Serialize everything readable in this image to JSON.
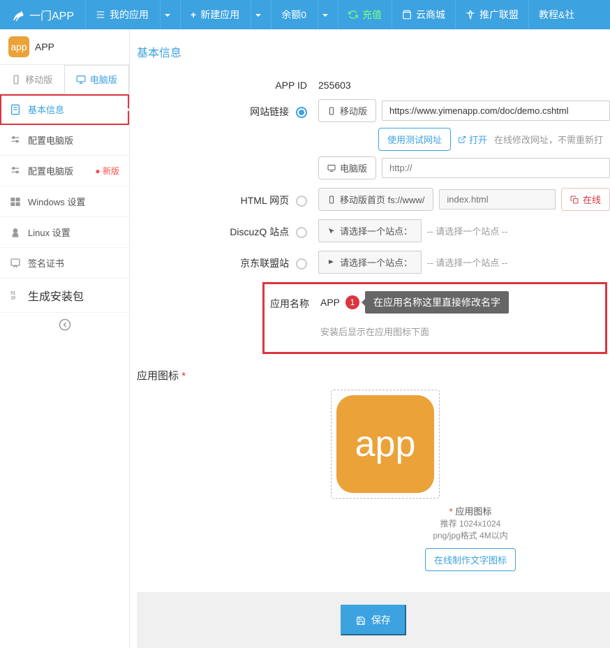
{
  "brand": "一门APP",
  "nav": {
    "my_apps": "我的应用",
    "new_app": "新建应用",
    "balance": "余额0",
    "recharge": "充值",
    "cloud_mall": "云商城",
    "promo": "推广联盟",
    "tutorial": "教程&社"
  },
  "app": {
    "name": "APP",
    "icon_text": "app"
  },
  "platform_tabs": {
    "mobile": "移动版",
    "desktop": "电脑版"
  },
  "menu": {
    "basic": "基本信息",
    "config_desktop": "配置电脑版",
    "config_desktop_new": "配置电脑版",
    "new_badge": "● 新版",
    "windows": "Windows 设置",
    "linux": "Linux 设置",
    "signing": "签名证书",
    "build": "生成安装包"
  },
  "section": {
    "title": "基本信息"
  },
  "fields": {
    "app_id_label": "APP ID",
    "app_id_value": "255603",
    "url_label": "网站链接",
    "mobile_btn": "移动版",
    "mobile_url": "https://www.yimenapp.com/doc/demo.cshtml",
    "test_url_btn": "使用测试网址",
    "open_link": "打开",
    "url_hint": "在线修改网址，不需重新打",
    "desktop_btn": "电脑版",
    "desktop_placeholder": "http://",
    "html_label": "HTML 网页",
    "html_btn": "移动版首页 fs://www/",
    "html_placeholder": "index.html",
    "html_right_btn": "在线",
    "discuz_label": "DiscuzQ 站点",
    "discuz_select": "请选择一个站点：",
    "discuz_placeholder": "-- 请选择一个站点 --",
    "jd_label": "京东联盟站",
    "jd_select": "请选择一个站点：",
    "jd_placeholder": "-- 请选择一个站点 --",
    "app_name_label": "应用名称",
    "app_name_value": "APP",
    "badge_num": "1",
    "tooltip": "在应用名称这里直接修改名字",
    "app_name_hint": "安装后显示在应用图标下面"
  },
  "icon": {
    "section_title": "应用图标",
    "label": "应用图标",
    "size_hint": "推荐 1024x1024",
    "format_hint": "png/jpg格式 4M以内",
    "make_btn": "在线制作文字图标",
    "large_text": "app"
  },
  "footer": {
    "save": "保存"
  }
}
